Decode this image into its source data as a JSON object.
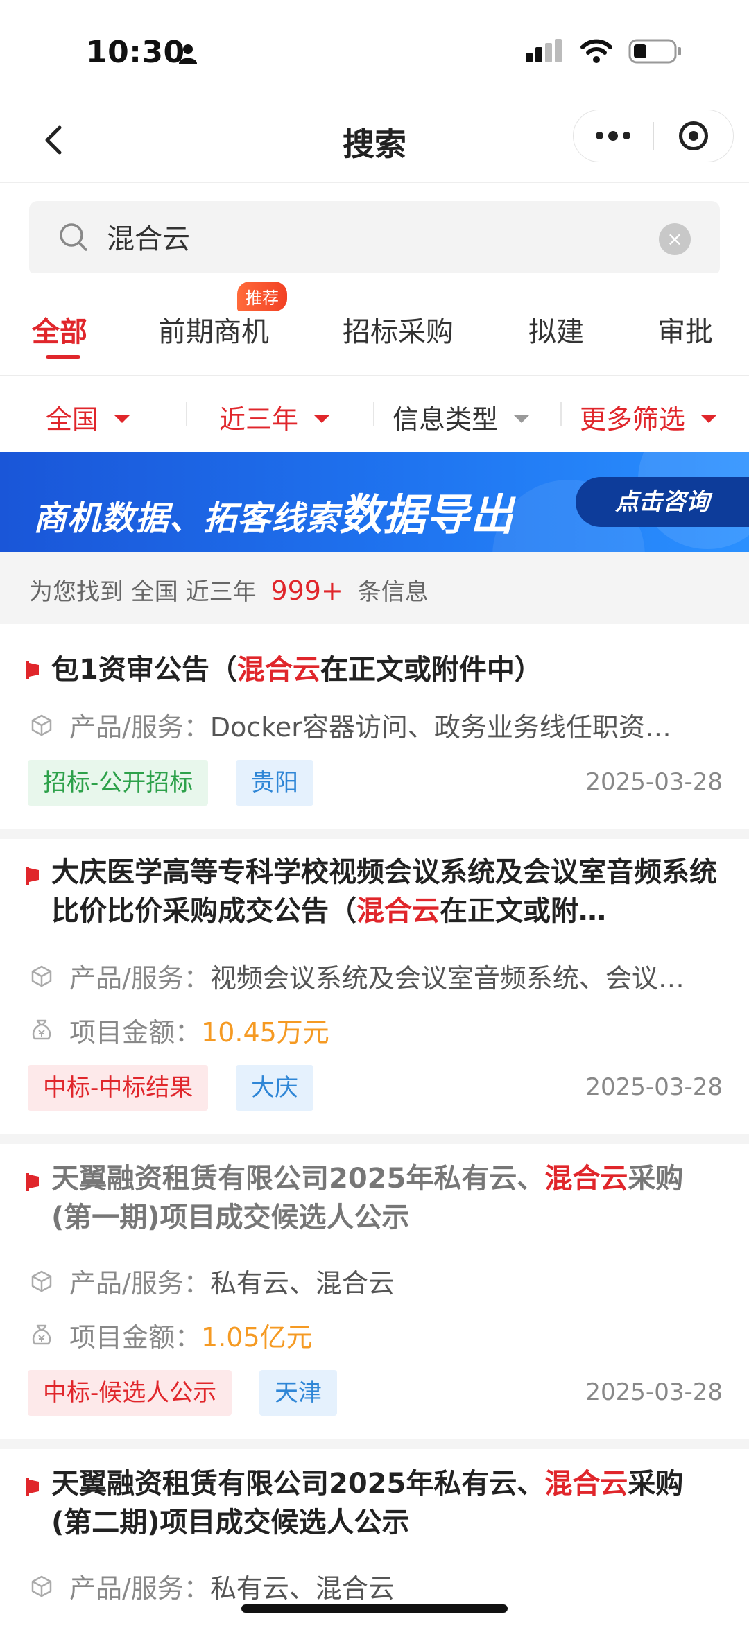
{
  "status_bar": {
    "time": "10:30"
  },
  "nav": {
    "title": "搜索"
  },
  "search": {
    "value": "混合云",
    "clear_symbol": "×"
  },
  "tabs": [
    {
      "label": "全部",
      "active": true
    },
    {
      "label": "前期商机",
      "badge": "推荐"
    },
    {
      "label": "招标采购"
    },
    {
      "label": "拟建"
    },
    {
      "label": "审批"
    }
  ],
  "filters": [
    {
      "label": "全国"
    },
    {
      "label": "近三年"
    },
    {
      "label": "信息类型"
    },
    {
      "label": "更多筛选"
    }
  ],
  "banner": {
    "text_a": "商机数据、拓客线索",
    "text_b": "数据导出",
    "button": "点击咨询"
  },
  "summary": {
    "prefix": "为您找到  全国  近三年",
    "count": "999+",
    "suffix": "条信息"
  },
  "results": [
    {
      "title_pre": "包1资审公告（",
      "title_hl": "混合云",
      "title_post": "在正文或附件中）",
      "product_label": "产品/服务：",
      "product_value": "Docker容器访问、政务业务线任职资…",
      "tags": [
        "招标-公开招标",
        "贵阳"
      ],
      "date": "2025-03-28"
    },
    {
      "title_pre": "大庆医学高等专科学校视频会议系统及会议室音频系统比价比价采购成交公告（",
      "title_hl": "混合云",
      "title_post": "在正文或附…",
      "product_label": "产品/服务：",
      "product_value": "视频会议系统及会议室音频系统、会议…",
      "amount_label": "项目金额：",
      "amount_value": "10.45万元",
      "tags": [
        "中标-中标结果",
        "大庆"
      ],
      "date": "2025-03-28"
    },
    {
      "title_pre": "天翼融资租赁有限公司2025年私有云、",
      "title_hl": "混合云",
      "title_post": "采购(第一期)项目成交候选人公示",
      "product_label": "产品/服务：",
      "product_value": "私有云、混合云",
      "amount_label": "项目金额：",
      "amount_value": "1.05亿元",
      "tags": [
        "中标-候选人公示",
        "天津"
      ],
      "date": "2025-03-28"
    },
    {
      "title_pre": "天翼融资租赁有限公司2025年私有云、",
      "title_hl": "混合云",
      "title_post": "采购(第二期)项目成交候选人公示",
      "product_label": "产品/服务：",
      "product_value": "私有云、混合云"
    }
  ],
  "colors": {
    "accent": "#e0262b",
    "money": "#f59a23",
    "banner": "#1f74f0"
  }
}
